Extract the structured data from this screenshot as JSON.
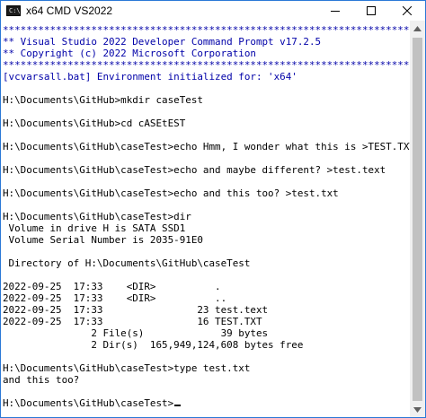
{
  "window": {
    "title": "x64 CMD VS2022",
    "icon_text": "C:\\",
    "colors": {
      "border": "#2b79d7",
      "console_bg": "#ffffff",
      "text": "#000000",
      "header_text": "#0000a8"
    }
  },
  "controls": {
    "minimize_icon": "minimize-icon",
    "maximize_icon": "maximize-icon",
    "close_icon": "close-icon"
  },
  "console": {
    "lines": [
      "**********************************************************************",
      "** Visual Studio 2022 Developer Command Prompt v17.2.5",
      "** Copyright (c) 2022 Microsoft Corporation",
      "**********************************************************************",
      "[vcvarsall.bat] Environment initialized for: 'x64'",
      "",
      "H:\\Documents\\GitHub>mkdir caseTest",
      "",
      "H:\\Documents\\GitHub>cd cASEtEST",
      "",
      "H:\\Documents\\GitHub\\caseTest>echo Hmm, I wonder what this is >TEST.TXT",
      "",
      "H:\\Documents\\GitHub\\caseTest>echo and maybe different? >test.text",
      "",
      "H:\\Documents\\GitHub\\caseTest>echo and this too? >test.txt",
      "",
      "H:\\Documents\\GitHub\\caseTest>dir",
      " Volume in drive H is SATA SSD1",
      " Volume Serial Number is 2035-91E0",
      "",
      " Directory of H:\\Documents\\GitHub\\caseTest",
      "",
      "2022-09-25  17:33    <DIR>          .",
      "2022-09-25  17:33    <DIR>          ..",
      "2022-09-25  17:33                23 test.text",
      "2022-09-25  17:33                16 TEST.TXT",
      "               2 File(s)             39 bytes",
      "               2 Dir(s)  165,949,124,608 bytes free",
      "",
      "H:\\Documents\\GitHub\\caseTest>type test.txt",
      "and this too?",
      "",
      "H:\\Documents\\GitHub\\caseTest>"
    ]
  }
}
